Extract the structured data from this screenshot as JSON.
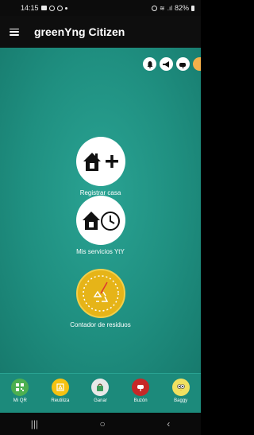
{
  "status_bar": {
    "time": "14:15",
    "battery": "82%"
  },
  "app_bar": {
    "title": "greenYng Citizen"
  },
  "top_actions": [
    {
      "icon": "bell-icon"
    },
    {
      "icon": "megaphone-icon"
    },
    {
      "icon": "mailbox-icon"
    },
    {
      "icon": "profile-avatar-icon"
    }
  ],
  "menu": {
    "register_house": {
      "label": "Registrar casa",
      "icon": "house-plus-icon"
    },
    "services": {
      "label": "Mis servicios YtY",
      "icon": "house-clock-icon"
    },
    "waste_counter": {
      "label": "Contador de residuos",
      "icon": "recycle-gauge-icon"
    }
  },
  "bottom_nav": [
    {
      "label": "Mi QR",
      "icon": "qr-code-icon",
      "color": "#4caf50"
    },
    {
      "label": "Reutiliza",
      "icon": "reuse-icon",
      "color": "#f5c211"
    },
    {
      "label": "Ganar",
      "icon": "gift-bag-icon",
      "color": "#3a9b5a"
    },
    {
      "label": "Buzón",
      "icon": "mailbox-icon",
      "color": "#c62828"
    },
    {
      "label": "Baggy",
      "icon": "owl-mascot-icon",
      "color": "#f0e060"
    }
  ],
  "colors": {
    "accent": "#1f8f80",
    "gold": "#e6b418"
  }
}
